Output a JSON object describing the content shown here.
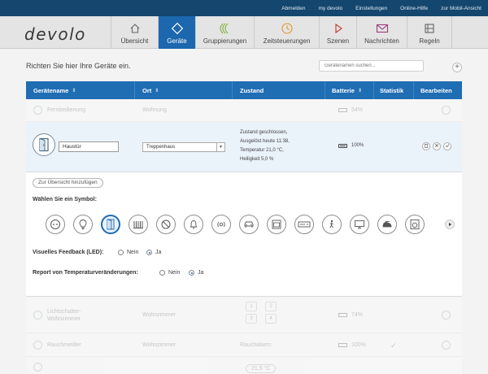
{
  "top_links": [
    "Abmelden",
    "my devolo",
    "Einstellungen",
    "Online-Hilfe",
    "zur Mobil-Ansicht"
  ],
  "logo": "devolo",
  "nav_tabs": [
    {
      "label": "Übersicht",
      "icon": "home-icon"
    },
    {
      "label": "Geräte",
      "icon": "device-diamond-icon",
      "active": true
    },
    {
      "label": "Gruppierungen",
      "icon": "groups-icon"
    },
    {
      "label": "Zeitsteuerungen",
      "icon": "clock-icon"
    },
    {
      "label": "Szenen",
      "icon": "play-icon"
    },
    {
      "label": "Nachrichten",
      "icon": "envelope-icon"
    },
    {
      "label": "Regeln",
      "icon": "rules-icon"
    }
  ],
  "intro_text": "Richten Sie hier Ihre Geräte ein.",
  "search_placeholder": "Gerätenamen suchen...",
  "add_label": "+",
  "columns": [
    "Gerätename",
    "Ort",
    "Zustand",
    "Batterie",
    "Statistik",
    "Bearbeiten"
  ],
  "sort_glyph": "⇕",
  "rows_before": [
    {
      "name": "Fernbedienung",
      "location": "Wohnung",
      "battery": "54%"
    }
  ],
  "selected": {
    "name_value": "Haustür",
    "location_value": "Treppenhaus",
    "state_lines": [
      "Zustand geschlossen,",
      "Ausgelöst heute 11:38,",
      "Temperatur 21,0 °C,",
      "Helligkeit 5,0 %"
    ],
    "battery": "100%",
    "action_icons": [
      "trash-icon",
      "close-icon",
      "check-icon"
    ]
  },
  "detail": {
    "overview_button": "Zur Übersicht hinzufügen",
    "symbol_label": "Wählen Sie ein Symbol:",
    "symbols": [
      "socket-icon",
      "bulb-icon",
      "door-icon",
      "radiator-icon",
      "prohibit-icon",
      "bell-icon",
      "siren-icon",
      "car-icon",
      "oven-icon",
      "dvd-icon",
      "motion-icon",
      "monitor-icon",
      "iron-icon",
      "washer-icon"
    ],
    "selected_symbol": 2,
    "led_label": "Visuelles Feedback (LED):",
    "temp_label": "Report von Temperaturveränderungen:",
    "opt_no": "Nein",
    "opt_yes": "Ja"
  },
  "rows_after": [
    {
      "name": "Lichtschalter-Wohnzimmer",
      "location": "Wohnzimmer",
      "battery": "74%",
      "keys": [
        "1",
        "2",
        "3",
        "4"
      ]
    },
    {
      "name": "Rauchmelder",
      "location": "Wohnzimmer",
      "state": "Rauchalarm:",
      "battery": "100%",
      "stat": "✓"
    },
    {
      "thermo_value": "21,5 °C"
    }
  ]
}
